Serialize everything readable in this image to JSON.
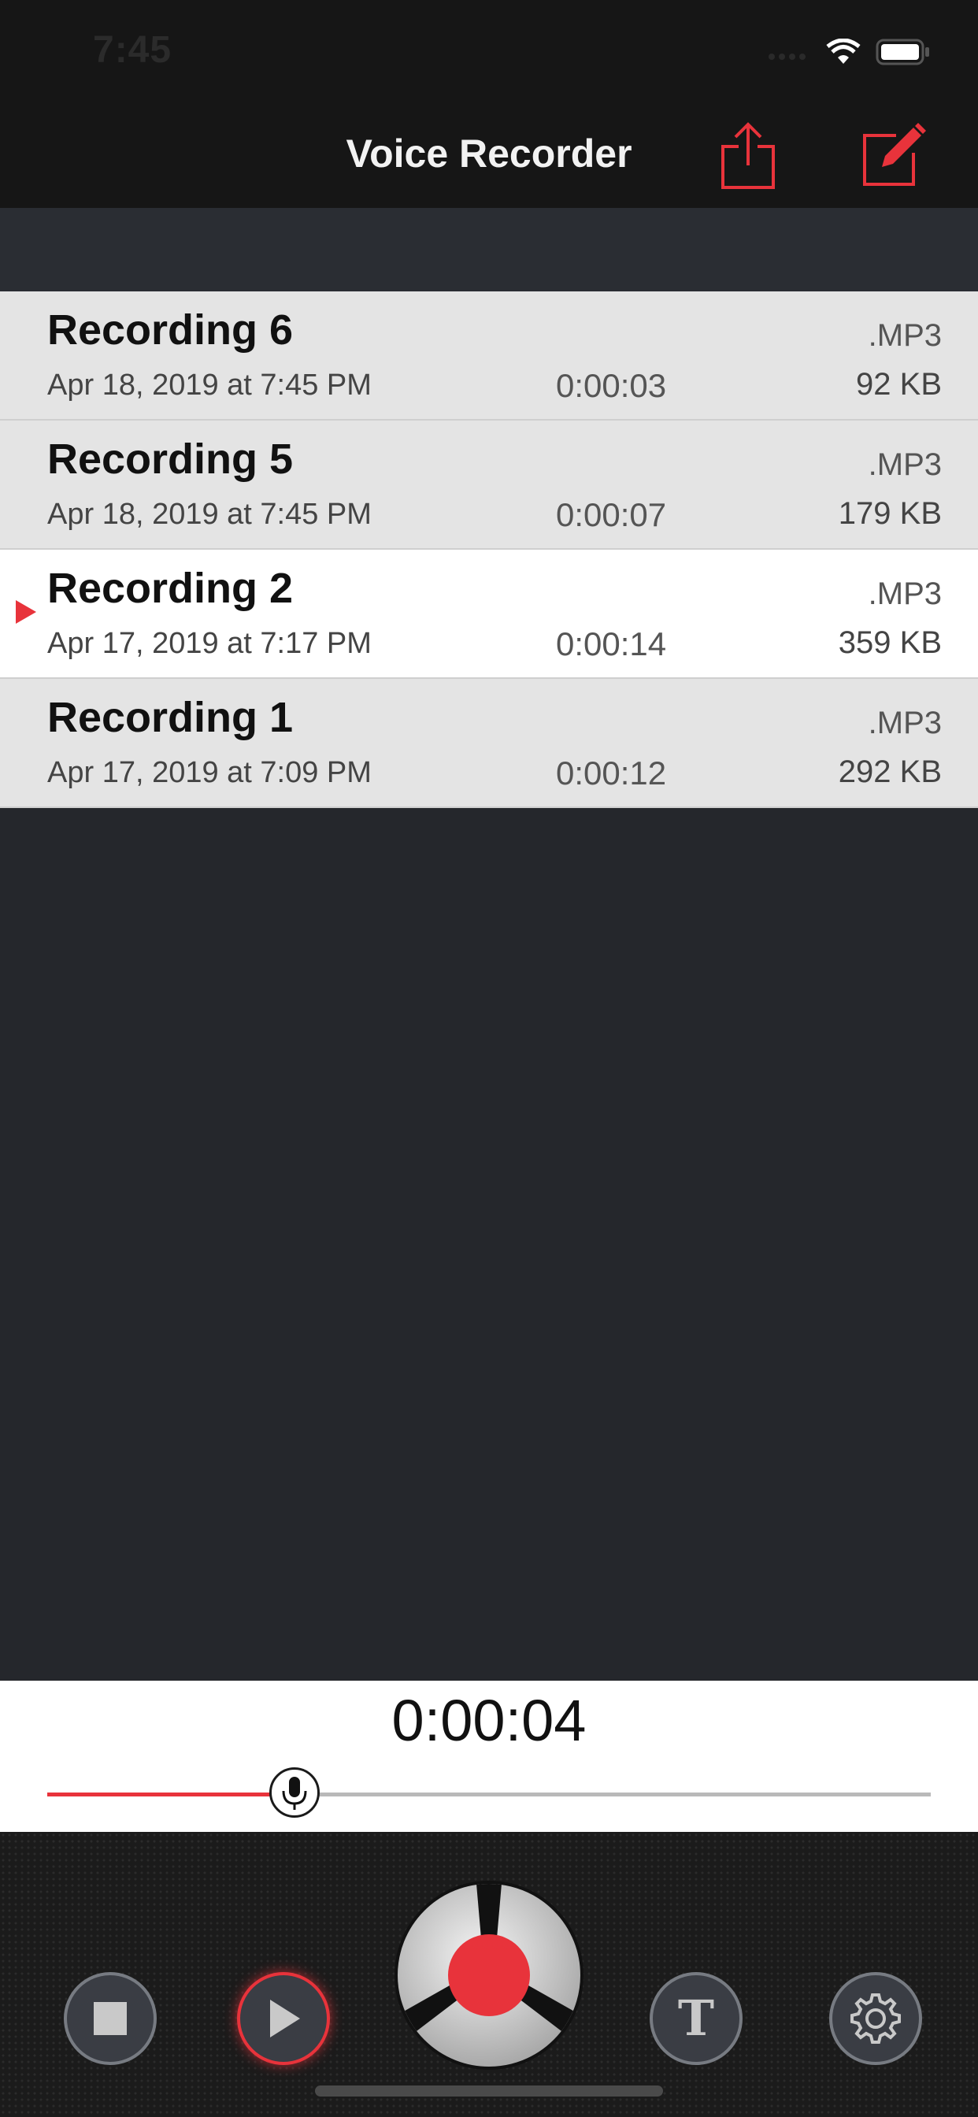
{
  "status": {
    "time": "7:45"
  },
  "nav": {
    "title": "Voice Recorder"
  },
  "recordings": [
    {
      "title": "Recording 6",
      "date": "Apr 18, 2019 at 7:45 PM",
      "duration": "0:00:03",
      "ext": ".MP3",
      "size": "92 KB",
      "active": false
    },
    {
      "title": "Recording 5",
      "date": "Apr 18, 2019 at 7:45 PM",
      "duration": "0:00:07",
      "ext": ".MP3",
      "size": "179 KB",
      "active": false
    },
    {
      "title": "Recording 2",
      "date": "Apr 17, 2019 at 7:17 PM",
      "duration": "0:00:14",
      "ext": ".MP3",
      "size": "359 KB",
      "active": true
    },
    {
      "title": "Recording 1",
      "date": "Apr 17, 2019 at 7:09 PM",
      "duration": "0:00:12",
      "ext": ".MP3",
      "size": "292 KB",
      "active": false
    }
  ],
  "player": {
    "time": "0:00:04",
    "progress": 0.28
  },
  "controls": {
    "stop_icon": "stop-icon",
    "play_icon": "play-icon",
    "record_icon": "record-icon",
    "text_icon": "text-icon",
    "settings_icon": "gear-icon",
    "text_glyph": "T"
  },
  "colors": {
    "accent": "#e8333b",
    "background": "#25272c",
    "navbar": "#161616"
  }
}
